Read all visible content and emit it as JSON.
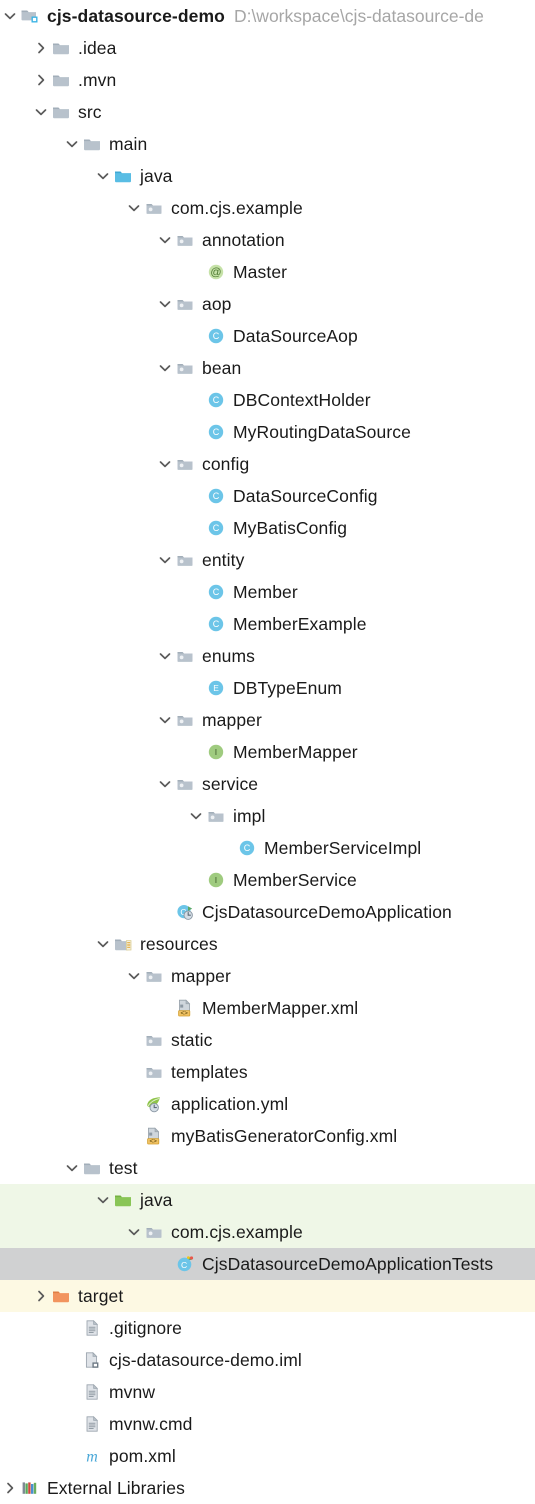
{
  "window": {
    "kind": "project-tree",
    "colors": {
      "folder_gray": "#a9b7c6",
      "folder_blue": "#54b3e0",
      "folder_green": "#89c556",
      "folder_orange": "#f2945e",
      "class_blue": "#6cc5e8",
      "interface_green": "#9fcb7f",
      "annotation_green": "#9fcb7f",
      "selection_gray": "#d0d1d2",
      "test_highlight_green": "#eff7e7",
      "target_highlight_yellow": "#fdf9e3",
      "text": "#1a1a1a",
      "path_text": "#a6a6a6"
    }
  },
  "root": {
    "label": "cjs-datasource-demo",
    "path": "D:\\workspace\\cjs-datasource-de",
    "icon": "module-folder-icon",
    "expanded": true,
    "bold": true
  },
  "nodes": [
    {
      "label": "cjs-datasource-demo",
      "path": "D:\\workspace\\cjs-datasource-de",
      "depth": 0,
      "icon": "module-folder-icon",
      "arrow": "down",
      "bold": true,
      "highlight": "none"
    },
    {
      "label": ".idea",
      "depth": 1,
      "icon": "folder-gray-icon",
      "arrow": "right",
      "bold": false,
      "highlight": "none"
    },
    {
      "label": ".mvn",
      "depth": 1,
      "icon": "folder-gray-icon",
      "arrow": "right",
      "bold": false,
      "highlight": "none"
    },
    {
      "label": "src",
      "depth": 1,
      "icon": "folder-gray-icon",
      "arrow": "down",
      "bold": false,
      "highlight": "none"
    },
    {
      "label": "main",
      "depth": 2,
      "icon": "folder-gray-icon",
      "arrow": "down",
      "bold": false,
      "highlight": "none"
    },
    {
      "label": "java",
      "depth": 3,
      "icon": "folder-blue-icon",
      "arrow": "down",
      "bold": false,
      "highlight": "none"
    },
    {
      "label": "com.cjs.example",
      "depth": 4,
      "icon": "package-icon",
      "arrow": "down",
      "bold": false,
      "highlight": "none"
    },
    {
      "label": "annotation",
      "depth": 5,
      "icon": "package-icon",
      "arrow": "down",
      "bold": false,
      "highlight": "none"
    },
    {
      "label": "Master",
      "depth": 6,
      "icon": "annotation-icon",
      "arrow": "none",
      "bold": false,
      "highlight": "none"
    },
    {
      "label": "aop",
      "depth": 5,
      "icon": "package-icon",
      "arrow": "down",
      "bold": false,
      "highlight": "none"
    },
    {
      "label": "DataSourceAop",
      "depth": 6,
      "icon": "class-icon",
      "arrow": "none",
      "bold": false,
      "highlight": "none"
    },
    {
      "label": "bean",
      "depth": 5,
      "icon": "package-icon",
      "arrow": "down",
      "bold": false,
      "highlight": "none"
    },
    {
      "label": "DBContextHolder",
      "depth": 6,
      "icon": "class-icon",
      "arrow": "none",
      "bold": false,
      "highlight": "none"
    },
    {
      "label": "MyRoutingDataSource",
      "depth": 6,
      "icon": "class-icon",
      "arrow": "none",
      "bold": false,
      "highlight": "none"
    },
    {
      "label": "config",
      "depth": 5,
      "icon": "package-icon",
      "arrow": "down",
      "bold": false,
      "highlight": "none"
    },
    {
      "label": "DataSourceConfig",
      "depth": 6,
      "icon": "class-icon",
      "arrow": "none",
      "bold": false,
      "highlight": "none"
    },
    {
      "label": "MyBatisConfig",
      "depth": 6,
      "icon": "class-icon",
      "arrow": "none",
      "bold": false,
      "highlight": "none"
    },
    {
      "label": "entity",
      "depth": 5,
      "icon": "package-icon",
      "arrow": "down",
      "bold": false,
      "highlight": "none"
    },
    {
      "label": "Member",
      "depth": 6,
      "icon": "class-icon",
      "arrow": "none",
      "bold": false,
      "highlight": "none"
    },
    {
      "label": "MemberExample",
      "depth": 6,
      "icon": "class-icon",
      "arrow": "none",
      "bold": false,
      "highlight": "none"
    },
    {
      "label": "enums",
      "depth": 5,
      "icon": "package-icon",
      "arrow": "down",
      "bold": false,
      "highlight": "none"
    },
    {
      "label": "DBTypeEnum",
      "depth": 6,
      "icon": "enum-icon",
      "arrow": "none",
      "bold": false,
      "highlight": "none"
    },
    {
      "label": "mapper",
      "depth": 5,
      "icon": "package-icon",
      "arrow": "down",
      "bold": false,
      "highlight": "none"
    },
    {
      "label": "MemberMapper",
      "depth": 6,
      "icon": "interface-icon",
      "arrow": "none",
      "bold": false,
      "highlight": "none"
    },
    {
      "label": "service",
      "depth": 5,
      "icon": "package-icon",
      "arrow": "down",
      "bold": false,
      "highlight": "none"
    },
    {
      "label": "impl",
      "depth": 6,
      "icon": "package-icon",
      "arrow": "down",
      "bold": false,
      "highlight": "none"
    },
    {
      "label": "MemberServiceImpl",
      "depth": 7,
      "icon": "class-icon",
      "arrow": "none",
      "bold": false,
      "highlight": "none"
    },
    {
      "label": "MemberService",
      "depth": 6,
      "icon": "interface-icon",
      "arrow": "none",
      "bold": false,
      "highlight": "none"
    },
    {
      "label": "CjsDatasourceDemoApplication",
      "depth": 5,
      "icon": "spring-boot-app-icon",
      "arrow": "none",
      "bold": false,
      "highlight": "none"
    },
    {
      "label": "resources",
      "depth": 3,
      "icon": "resources-folder-icon",
      "arrow": "down",
      "bold": false,
      "highlight": "none"
    },
    {
      "label": "mapper",
      "depth": 4,
      "icon": "package-icon",
      "arrow": "down",
      "bold": false,
      "highlight": "none"
    },
    {
      "label": "MemberMapper.xml",
      "depth": 5,
      "icon": "xml-file-icon",
      "arrow": "none",
      "bold": false,
      "highlight": "none"
    },
    {
      "label": "static",
      "depth": 4,
      "icon": "package-icon",
      "arrow": "none",
      "bold": false,
      "highlight": "none"
    },
    {
      "label": "templates",
      "depth": 4,
      "icon": "package-icon",
      "arrow": "none",
      "bold": false,
      "highlight": "none"
    },
    {
      "label": "application.yml",
      "depth": 4,
      "icon": "spring-yaml-icon",
      "arrow": "none",
      "bold": false,
      "highlight": "none"
    },
    {
      "label": "myBatisGeneratorConfig.xml",
      "depth": 4,
      "icon": "xml-file-icon",
      "arrow": "none",
      "bold": false,
      "highlight": "none"
    },
    {
      "label": "test",
      "depth": 2,
      "icon": "folder-gray-icon",
      "arrow": "down",
      "bold": false,
      "highlight": "none"
    },
    {
      "label": "java",
      "depth": 3,
      "icon": "folder-green-icon",
      "arrow": "down",
      "bold": false,
      "highlight": "test"
    },
    {
      "label": "com.cjs.example",
      "depth": 4,
      "icon": "package-icon",
      "arrow": "down",
      "bold": false,
      "highlight": "test"
    },
    {
      "label": "CjsDatasourceDemoApplicationTests",
      "depth": 5,
      "icon": "test-class-icon",
      "arrow": "none",
      "bold": false,
      "highlight": "selected"
    },
    {
      "label": "target",
      "depth": 1,
      "icon": "folder-orange-icon",
      "arrow": "right",
      "bold": false,
      "highlight": "target"
    },
    {
      "label": ".gitignore",
      "depth": 2,
      "icon": "text-file-icon",
      "arrow": "none",
      "bold": false,
      "highlight": "none"
    },
    {
      "label": "cjs-datasource-demo.iml",
      "depth": 2,
      "icon": "iml-file-icon",
      "arrow": "none",
      "bold": false,
      "highlight": "none"
    },
    {
      "label": "mvnw",
      "depth": 2,
      "icon": "text-file-icon",
      "arrow": "none",
      "bold": false,
      "highlight": "none"
    },
    {
      "label": "mvnw.cmd",
      "depth": 2,
      "icon": "text-file-icon",
      "arrow": "none",
      "bold": false,
      "highlight": "none"
    },
    {
      "label": "pom.xml",
      "depth": 2,
      "icon": "maven-pom-icon",
      "arrow": "none",
      "bold": false,
      "highlight": "none"
    },
    {
      "label": "External Libraries",
      "depth": 0,
      "icon": "external-libraries-icon",
      "arrow": "right",
      "bold": false,
      "highlight": "none"
    }
  ]
}
